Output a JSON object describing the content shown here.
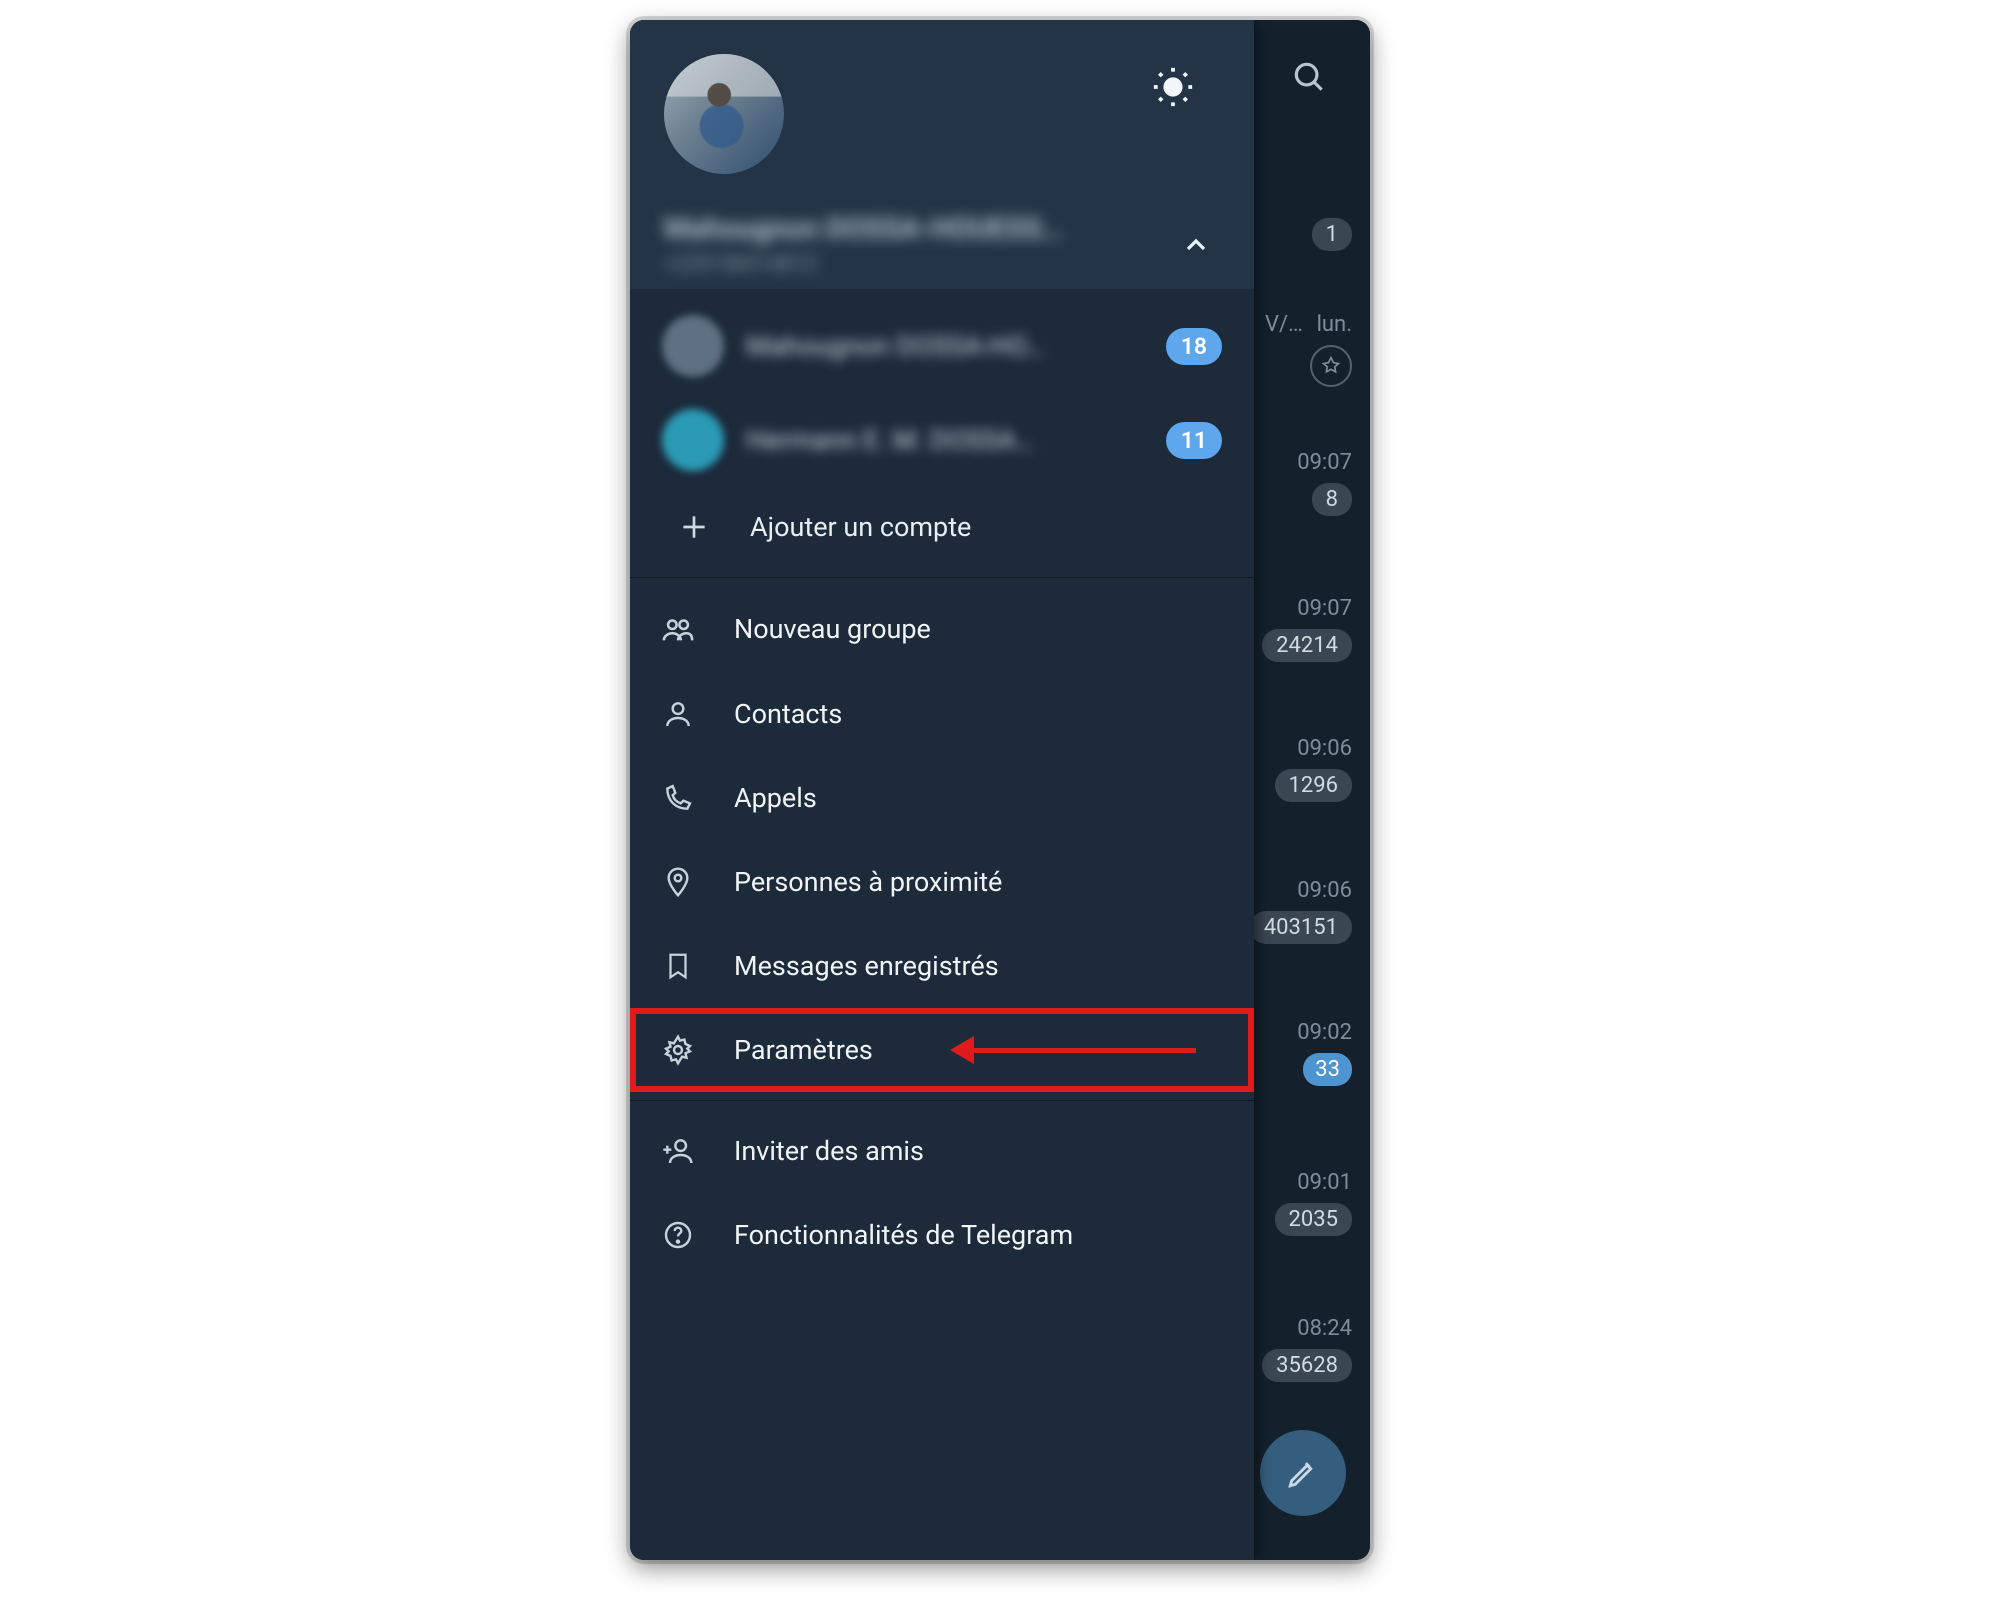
{
  "drawer": {
    "user_name_obscured": "Mahougnon DOSSA-HOUESS…",
    "user_phone_obscured": "+229 96014812",
    "accounts": [
      {
        "name_obscured": "Mahougnon DOSSA-HO…",
        "badge": "18"
      },
      {
        "name_obscured": "Hermann E. M. DOSSA…",
        "badge": "11"
      }
    ],
    "add_account": "Ajouter un compte",
    "menu": {
      "new_group": "Nouveau groupe",
      "contacts": "Contacts",
      "calls": "Appels",
      "people_nearby": "Personnes à proximité",
      "saved_messages": "Messages enregistrés",
      "settings": "Paramètres",
      "invite": "Inviter des amis",
      "features": "Fonctionnalités de Telegram"
    }
  },
  "chatlist": {
    "rows": [
      {
        "badge": "1",
        "day": "lun."
      },
      {
        "time": "09:07",
        "badge": "8"
      },
      {
        "time": "09:07",
        "badge": "24214"
      },
      {
        "time": "09:06",
        "badge": "1296"
      },
      {
        "time": "09:06",
        "badge": "403151"
      },
      {
        "time": "09:02",
        "badge_blue": "33"
      },
      {
        "time": "09:01",
        "badge": "2035"
      },
      {
        "time": "08:24",
        "badge": "35628"
      }
    ],
    "trailing": "V/…"
  }
}
